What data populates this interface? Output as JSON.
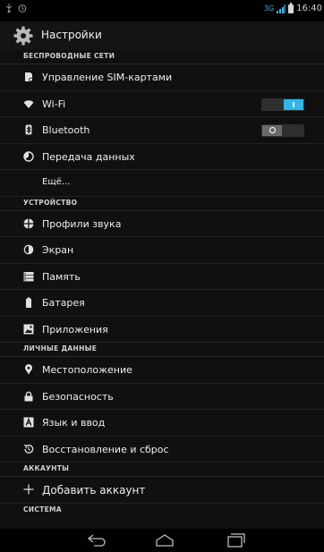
{
  "status_bar": {
    "network_type": "3G",
    "time": "16:40",
    "icons": [
      "usb-icon",
      "alarm-icon",
      "signal-icon",
      "battery-icon"
    ]
  },
  "action_bar": {
    "title": "Настройки",
    "icon": "settings-gear-icon"
  },
  "sections": {
    "wireless": "БЕСПРОВОДНЫЕ СЕТИ",
    "device": "УСТРОЙСТВО",
    "personal": "ЛИЧНЫЕ ДАННЫЕ",
    "accounts": "АККАУНТЫ",
    "system": "СИСТЕМА"
  },
  "items": {
    "sim": "Управление SIM-картами",
    "wifi": "Wi-Fi",
    "bluetooth": "Bluetooth",
    "data_usage": "Передача данных",
    "more": "Ещё...",
    "sound": "Профили звука",
    "display": "Экран",
    "storage": "Память",
    "battery": "Батарея",
    "apps": "Приложения",
    "location": "Местоположение",
    "security": "Безопасность",
    "language": "Язык и ввод",
    "backup": "Восстановление и сброс",
    "add_account": "Добавить аккаунт"
  },
  "toggles": {
    "wifi": "on",
    "bluetooth": "off"
  },
  "colors": {
    "accent": "#33b5e5",
    "background": "#101010",
    "text": "#eeeeee"
  }
}
